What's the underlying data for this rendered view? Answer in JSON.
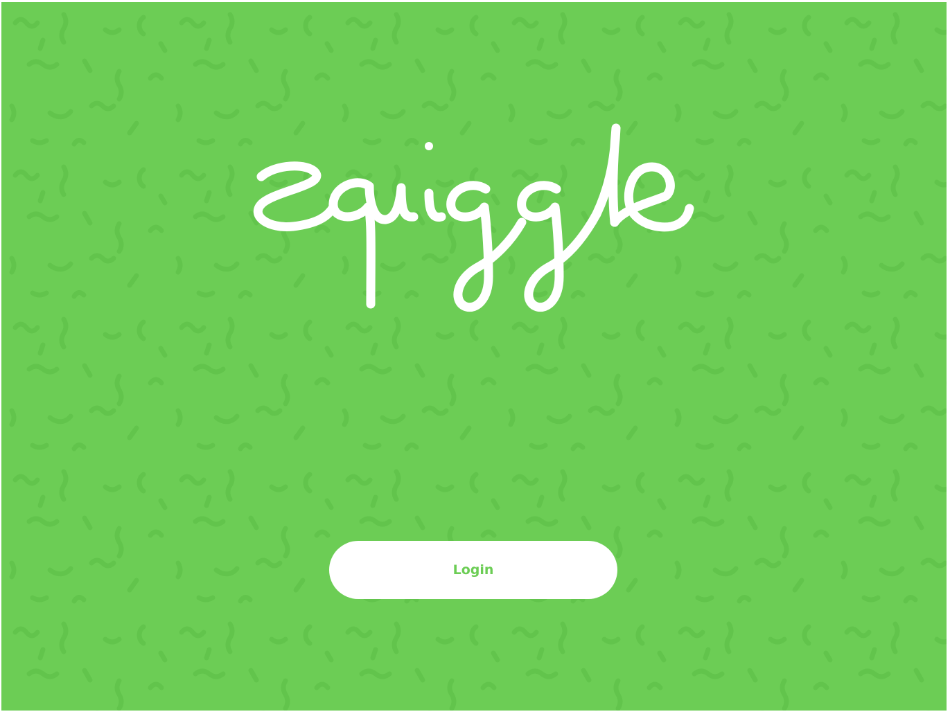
{
  "app": {
    "logo_text": "squiggle",
    "logo_icon": "squiggle-wordmark"
  },
  "login": {
    "label": "Login"
  },
  "colors": {
    "background": "#6ccd55",
    "pattern": "#62c44c",
    "logo": "#ffffff",
    "button_bg": "#ffffff",
    "button_text": "#6ccd55"
  }
}
